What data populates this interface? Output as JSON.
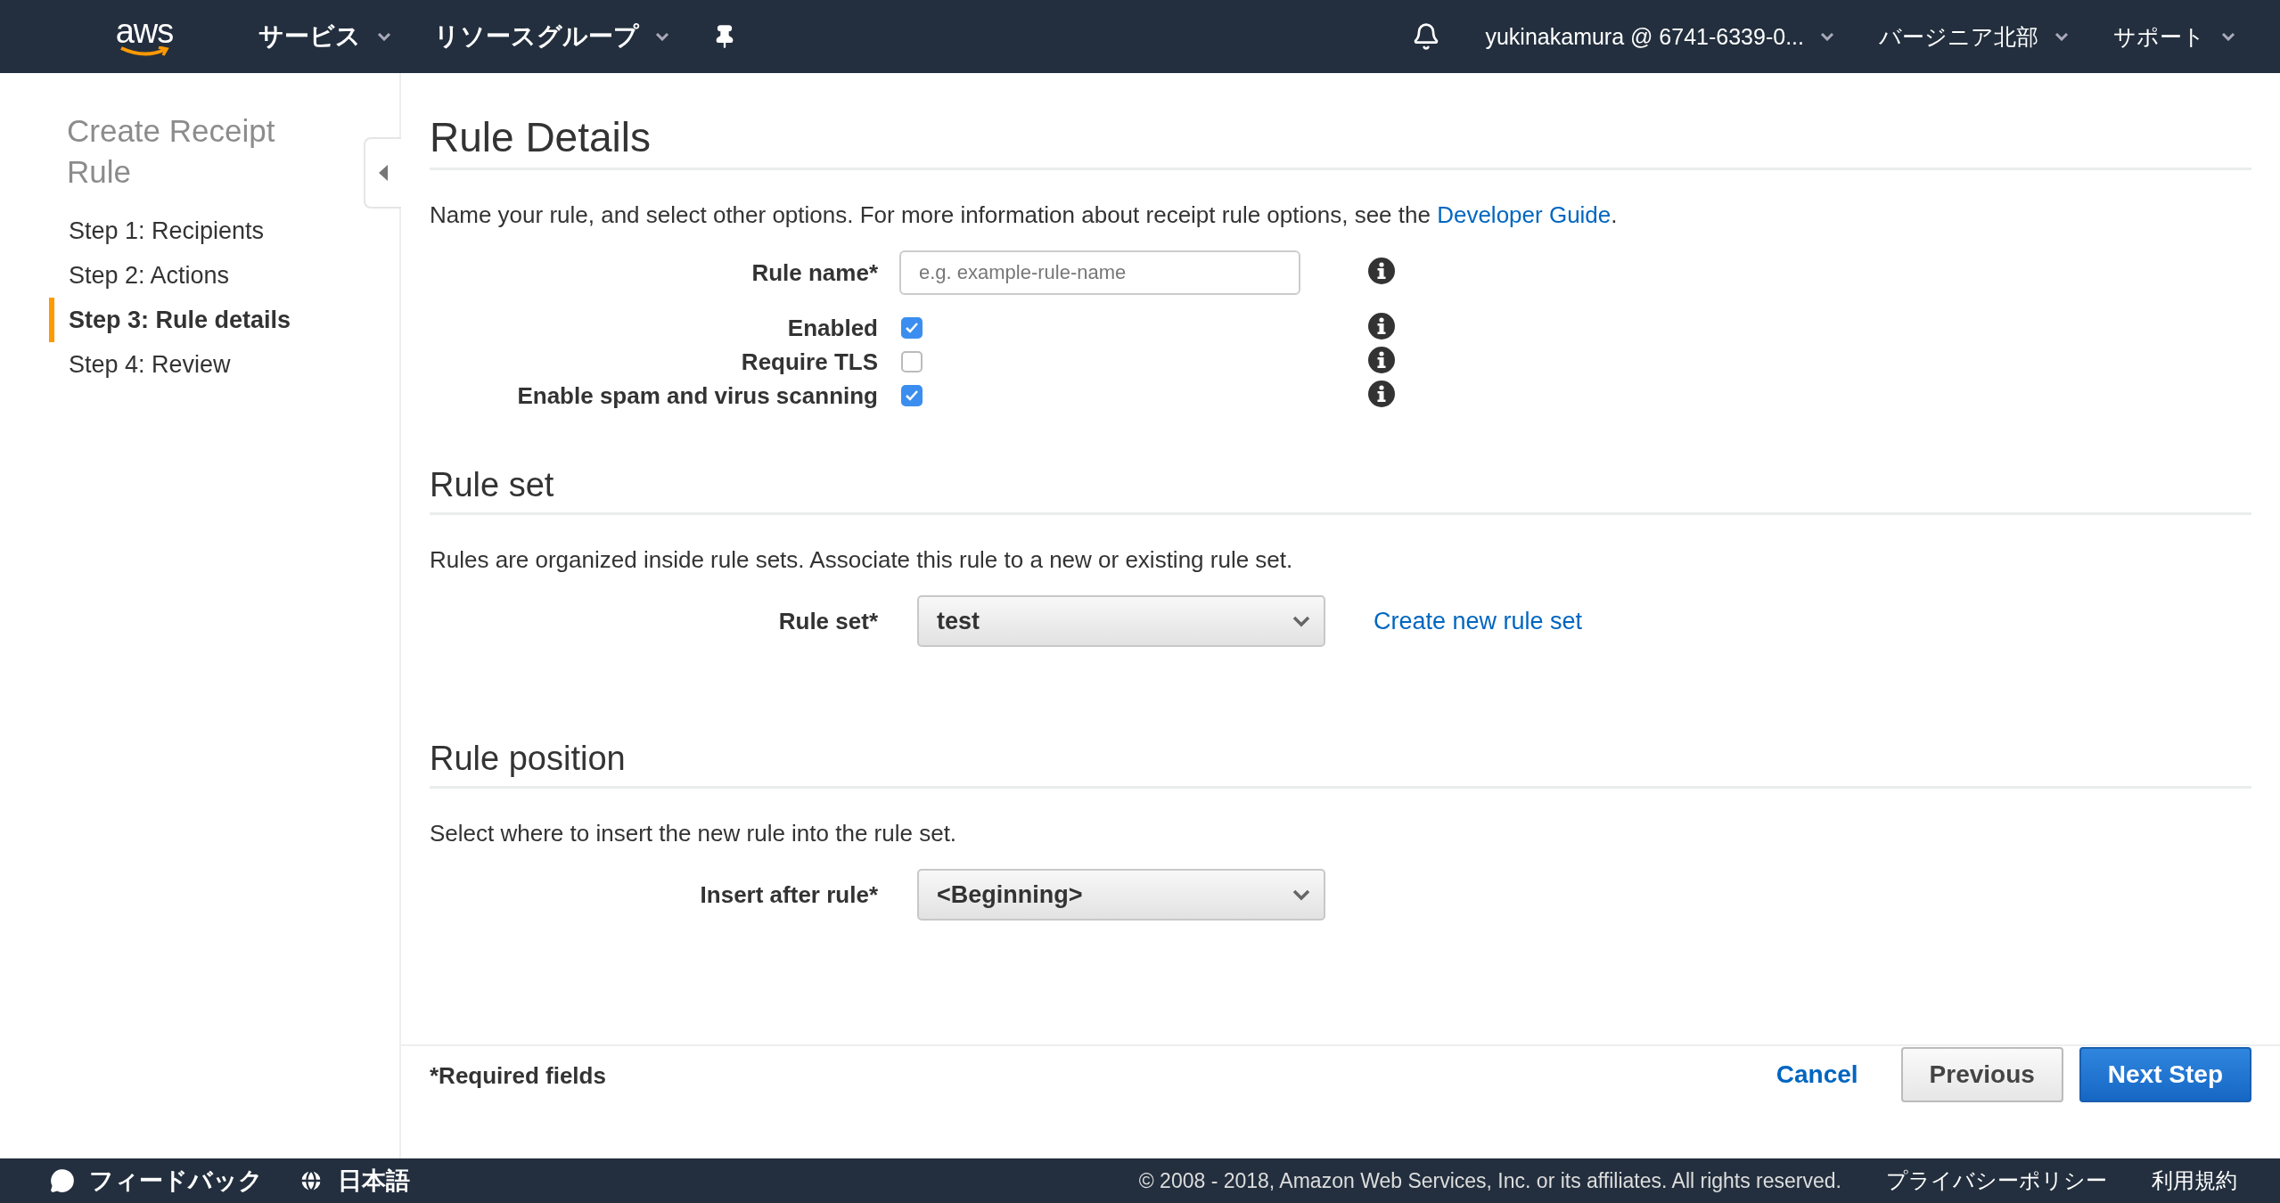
{
  "topbar": {
    "logo": "aws",
    "menus": [
      {
        "label": "サービス"
      },
      {
        "label": "リソースグループ"
      }
    ],
    "account": "yukinakamura @ 6741-6339-0...",
    "region": "バージニア北部",
    "support": "サポート"
  },
  "sidebar": {
    "title": "Create Receipt Rule",
    "steps": [
      {
        "label": "Step 1: Recipients",
        "selected": false
      },
      {
        "label": "Step 2: Actions",
        "selected": false
      },
      {
        "label": "Step 3: Rule details",
        "selected": true
      },
      {
        "label": "Step 4: Review",
        "selected": false
      }
    ]
  },
  "rule_details": {
    "title": "Rule Details",
    "description": "Name your rule, and select other options. For more information about receipt rule options, see the",
    "link": "Developer Guide",
    "description_end": ".",
    "rule_name": {
      "label": "Rule name*",
      "placeholder": "e.g. example-rule-name"
    },
    "options": [
      {
        "label": "Enabled",
        "checked": true
      },
      {
        "label": "Require TLS",
        "checked": false
      },
      {
        "label": "Enable spam and virus scanning",
        "checked": true
      }
    ]
  },
  "rule_set": {
    "title": "Rule set",
    "description": "Rules are organized inside rule sets. Associate this rule to a new or existing rule set.",
    "field": {
      "label": "Rule set*",
      "value": "test"
    },
    "link": "Create new rule set"
  },
  "rule_position": {
    "title": "Rule position",
    "description": "Select where to insert the new rule into the rule set.",
    "field": {
      "label": "Insert after rule*",
      "value": "<Beginning>"
    }
  },
  "actions": {
    "required_note": "*Required fields",
    "buttons": [
      {
        "label": "Cancel",
        "kind": "link"
      },
      {
        "label": "Previous",
        "kind": "secondary"
      },
      {
        "label": "Next Step",
        "kind": "primary"
      }
    ]
  },
  "footer": {
    "feedback": "フィードバック",
    "language": "日本語",
    "copyright": "© 2008 - 2018, Amazon Web Services, Inc. or its affiliates. All rights reserved.",
    "links": [
      "プライバシーポリシー",
      "利用規約"
    ]
  }
}
